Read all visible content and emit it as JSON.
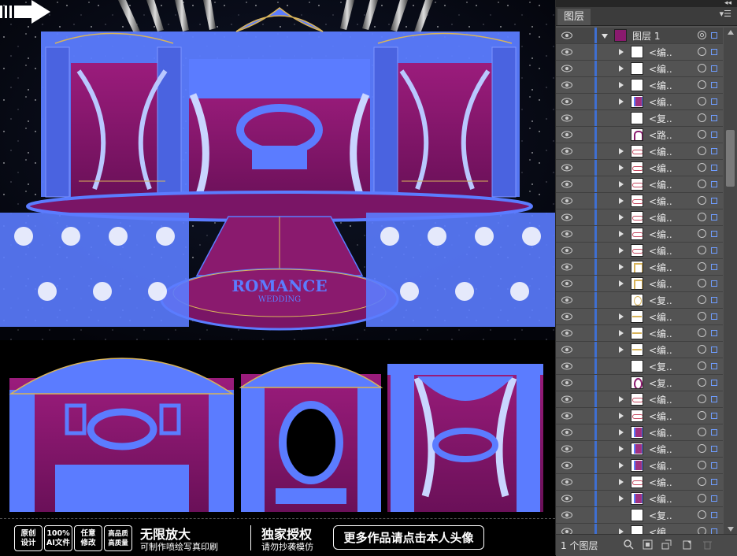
{
  "document": {
    "title_art": {
      "line1": "ROMANCE",
      "line2": "WEDDING"
    }
  },
  "banner": {
    "badges": [
      {
        "line1": "原创",
        "line2": "设计"
      },
      {
        "line1": "100%",
        "line2": "AI文件"
      },
      {
        "line1": "任意",
        "line2": "修改"
      },
      {
        "line1": "高品质",
        "line2": "高质量"
      }
    ],
    "headline1": "无限放大",
    "subline1": "可制作喷绘写真印刷",
    "headline2": "独家授权",
    "subline2": "请勿抄袭模仿",
    "cta": "更多作品请点击本人头像"
  },
  "layers_panel": {
    "tab": "图层",
    "top_layer": {
      "name": "图层 1"
    },
    "rows": [
      {
        "name": "<编..",
        "expand": true,
        "thumb": "blank"
      },
      {
        "name": "<编..",
        "expand": true,
        "thumb": "blank"
      },
      {
        "name": "<编..",
        "expand": true,
        "thumb": "blank"
      },
      {
        "name": "<编..",
        "expand": true,
        "thumb": "pillar"
      },
      {
        "name": "<复..",
        "expand": false,
        "thumb": "blank"
      },
      {
        "name": "<路..",
        "expand": false,
        "thumb": "arch"
      },
      {
        "name": "<编..",
        "expand": true,
        "thumb": "swirl"
      },
      {
        "name": "<编..",
        "expand": true,
        "thumb": "swirl"
      },
      {
        "name": "<编..",
        "expand": true,
        "thumb": "swirl"
      },
      {
        "name": "<编..",
        "expand": true,
        "thumb": "swirl"
      },
      {
        "name": "<编..",
        "expand": true,
        "thumb": "swirl"
      },
      {
        "name": "<编..",
        "expand": true,
        "thumb": "swirl"
      },
      {
        "name": "<编..",
        "expand": true,
        "thumb": "swirl"
      },
      {
        "name": "<编..",
        "expand": true,
        "thumb": "gold"
      },
      {
        "name": "<编..",
        "expand": true,
        "thumb": "gold"
      },
      {
        "name": "<复..",
        "expand": false,
        "thumb": "goldring"
      },
      {
        "name": "<编..",
        "expand": true,
        "thumb": "goldline"
      },
      {
        "name": "<编..",
        "expand": true,
        "thumb": "goldline"
      },
      {
        "name": "<编..",
        "expand": true,
        "thumb": "goldline"
      },
      {
        "name": "<复..",
        "expand": false,
        "thumb": "blank"
      },
      {
        "name": "<复..",
        "expand": false,
        "thumb": "oval"
      },
      {
        "name": "<编..",
        "expand": true,
        "thumb": "swirl"
      },
      {
        "name": "<编..",
        "expand": true,
        "thumb": "swirl"
      },
      {
        "name": "<编..",
        "expand": true,
        "thumb": "pillar"
      },
      {
        "name": "<编..",
        "expand": true,
        "thumb": "pillar"
      },
      {
        "name": "<编..",
        "expand": true,
        "thumb": "pillar"
      },
      {
        "name": "<编..",
        "expand": true,
        "thumb": "swirl"
      },
      {
        "name": "<编..",
        "expand": true,
        "thumb": "pillar"
      },
      {
        "name": "<复..",
        "expand": false,
        "thumb": "blank"
      },
      {
        "name": "<编..",
        "expand": true,
        "thumb": "blank"
      }
    ],
    "footer_count": "1 个图层"
  },
  "colors": {
    "accent_blue": "#5b7cff",
    "magenta": "#8a1a6e",
    "gold": "#d8b45a",
    "panel_bg": "#535353"
  }
}
